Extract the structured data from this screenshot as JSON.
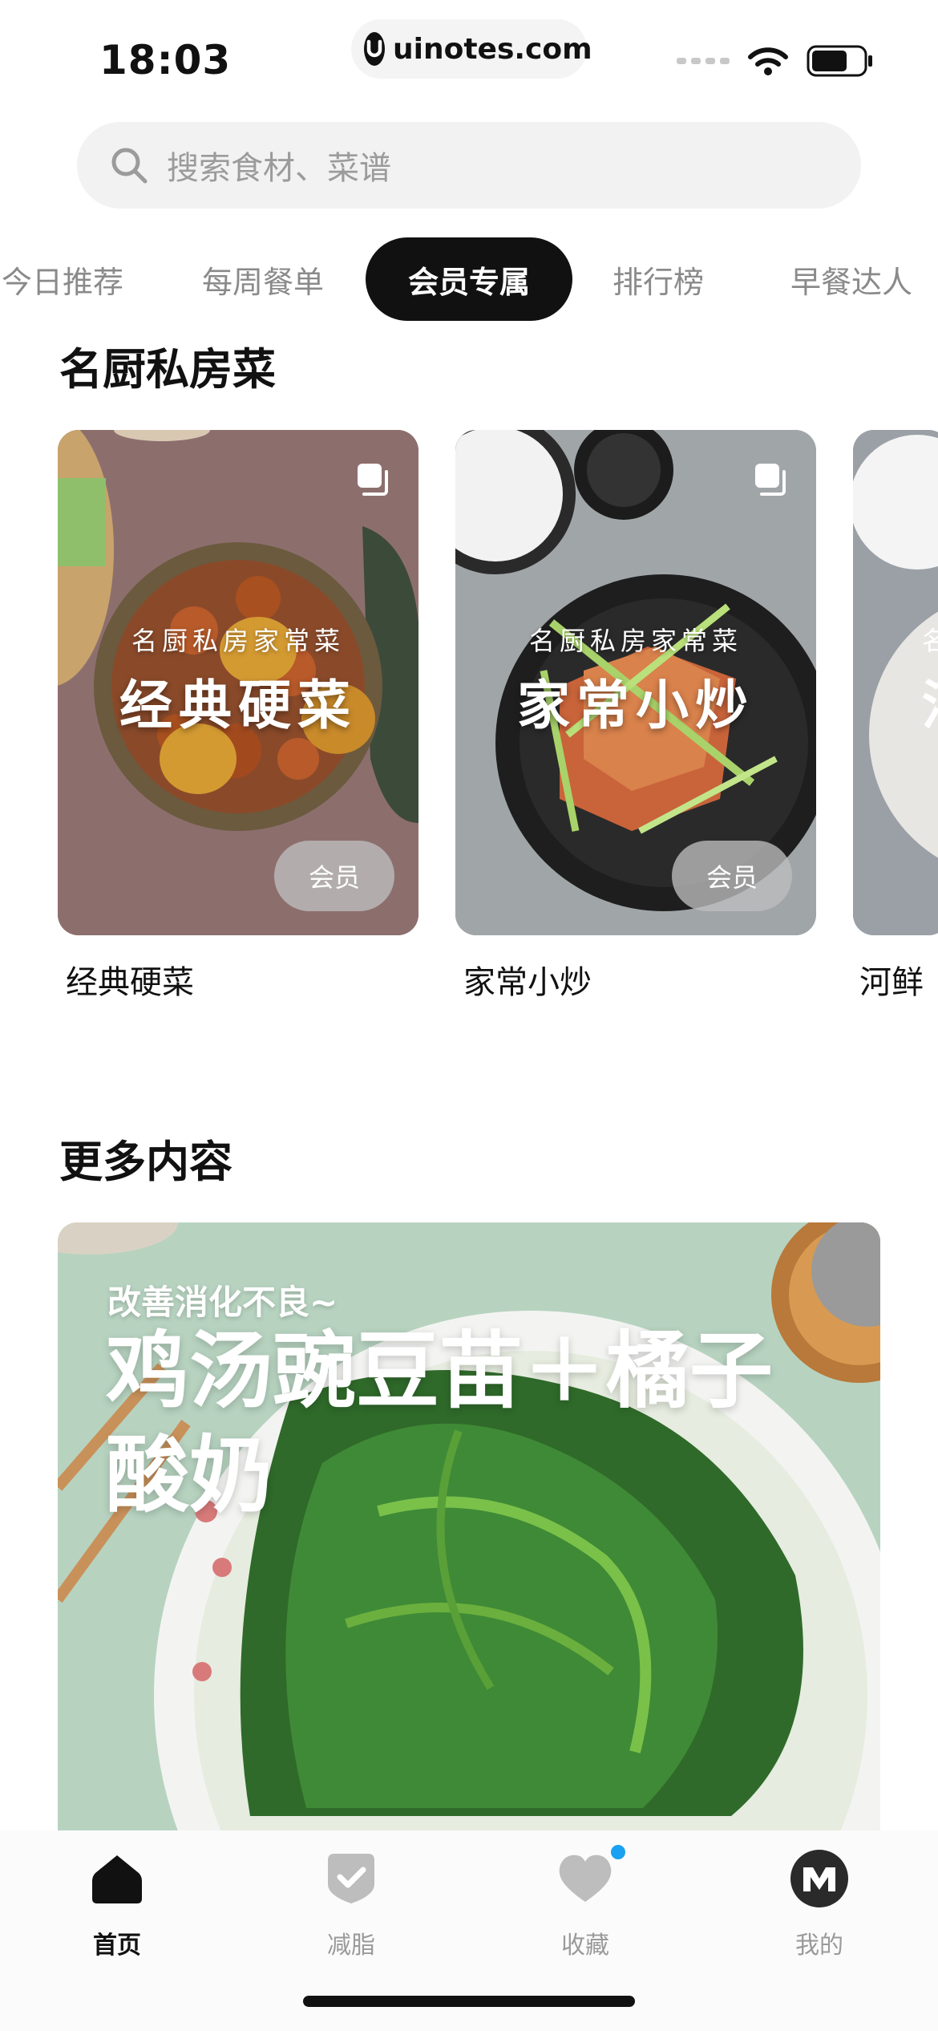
{
  "status_bar": {
    "time": "18:03",
    "url": "uinotes.com",
    "battery_level": 0.7
  },
  "search": {
    "placeholder": "搜索食材、菜谱"
  },
  "tabs": [
    {
      "label": "今日推荐",
      "active": false
    },
    {
      "label": "每周餐单",
      "active": false
    },
    {
      "label": "会员专属",
      "active": true
    },
    {
      "label": "排行榜",
      "active": false
    },
    {
      "label": "早餐达人",
      "active": false
    }
  ],
  "section_chef": {
    "title": "名厨私房菜",
    "cards": [
      {
        "subtitle": "名厨私房家常菜",
        "title": "经典硬菜",
        "badge": "会员",
        "caption": "经典硬菜"
      },
      {
        "subtitle": "名厨私房家常菜",
        "title": "家常小炒",
        "badge": "会员",
        "caption": "家常小炒"
      },
      {
        "subtitle": "名",
        "title": "河",
        "caption": "河鲜"
      }
    ]
  },
  "section_more": {
    "title": "更多内容",
    "feature": {
      "subtitle": "改善消化不良~",
      "title": "鸡汤豌豆苗＋橘子酸奶"
    }
  },
  "bottom_nav": [
    {
      "label": "首页",
      "icon": "home-icon",
      "active": true
    },
    {
      "label": "减脂",
      "icon": "check-shield-icon",
      "active": false
    },
    {
      "label": "收藏",
      "icon": "heart-icon",
      "active": false,
      "has_dot": true
    },
    {
      "label": "我的",
      "icon": "avatar-icon",
      "active": false
    }
  ],
  "colors": {
    "accent": "#111111",
    "notification_dot": "#1aa1f0",
    "muted": "#9a9a9a"
  }
}
